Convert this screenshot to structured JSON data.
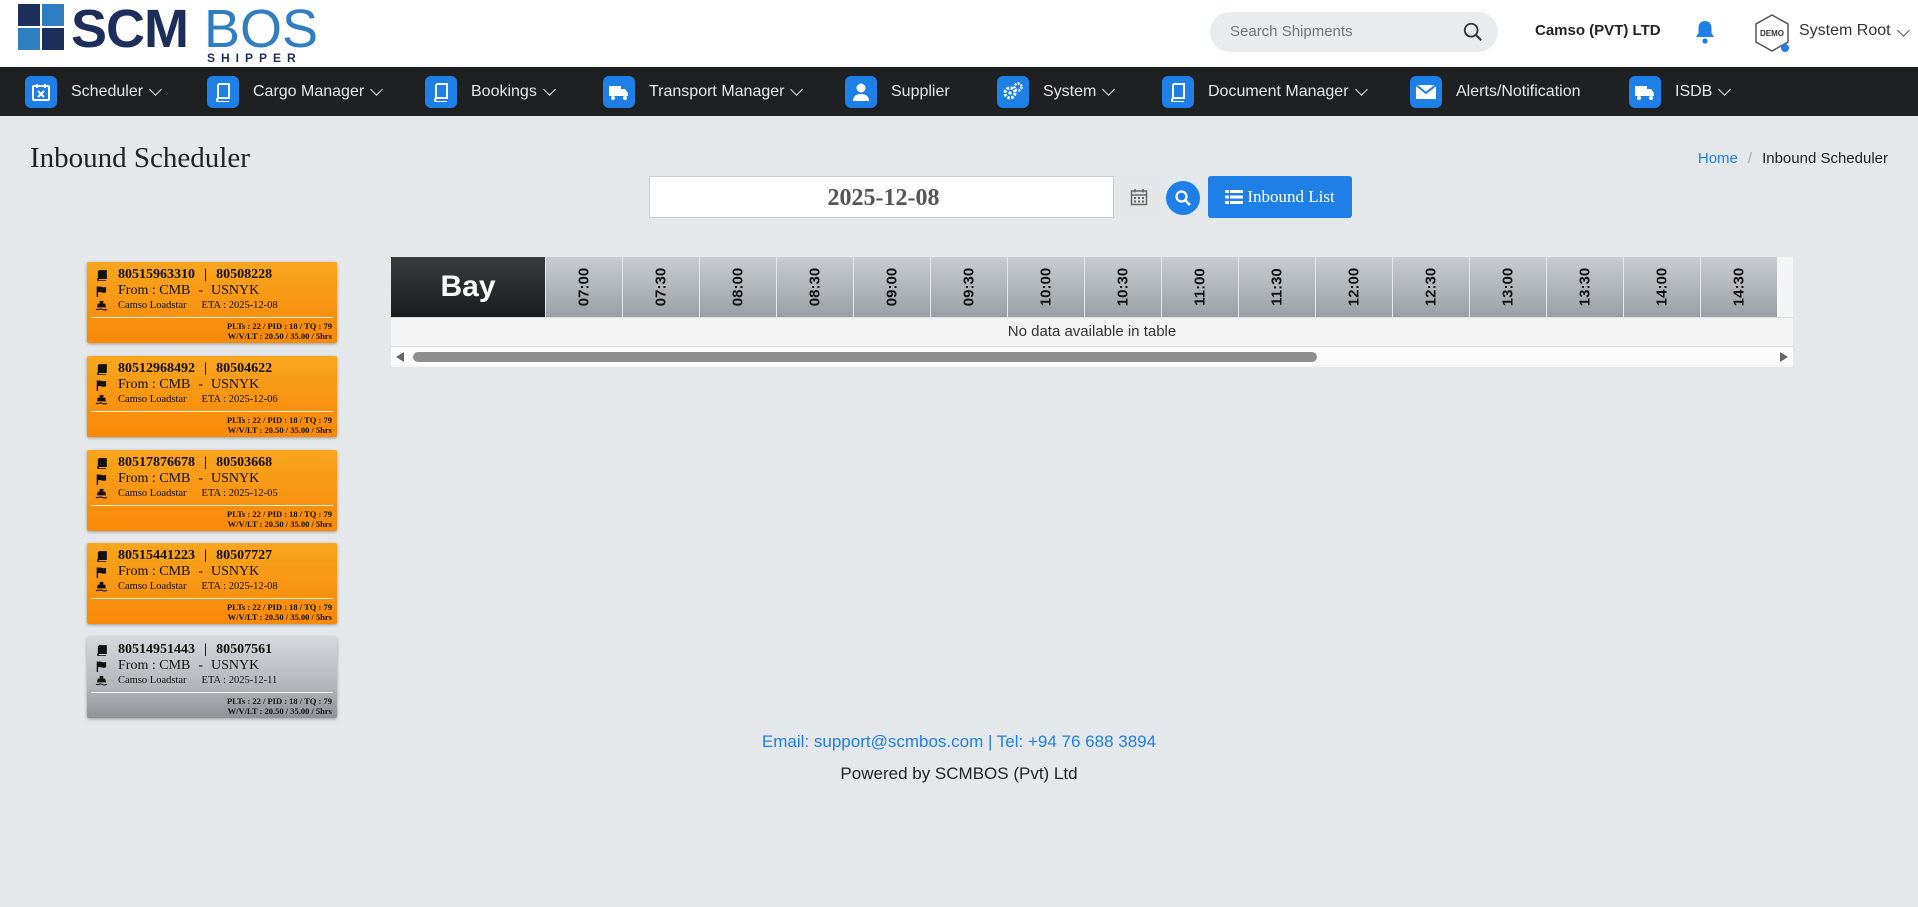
{
  "header": {
    "logo_main": "SCM",
    "logo_accent": "BOS",
    "logo_sub": "SHIPPER",
    "search_placeholder": "Search Shipments",
    "company": "Camso (PVT) LTD",
    "user_name": "System Root",
    "avatar_text": "DEMO"
  },
  "nav": [
    {
      "label": "Scheduler",
      "icon": "calendar-icon",
      "dropdown": true
    },
    {
      "label": "Cargo Manager",
      "icon": "book-icon",
      "dropdown": true
    },
    {
      "label": "Bookings",
      "icon": "book-icon",
      "dropdown": true
    },
    {
      "label": "Transport Manager",
      "icon": "truck-icon",
      "dropdown": true
    },
    {
      "label": "Supplier",
      "icon": "user-icon",
      "dropdown": false
    },
    {
      "label": "System",
      "icon": "gears-icon",
      "dropdown": true
    },
    {
      "label": "Document Manager",
      "icon": "book-icon",
      "dropdown": true
    },
    {
      "label": "Alerts/Notification",
      "icon": "envelope-icon",
      "dropdown": false
    },
    {
      "label": "ISDB",
      "icon": "truck-icon",
      "dropdown": true
    }
  ],
  "page": {
    "title": "Inbound Scheduler",
    "breadcrumb_home": "Home",
    "breadcrumb_current": "Inbound Scheduler",
    "date_value": "2025-12-08",
    "inbound_list_label": "Inbound List"
  },
  "cards": [
    {
      "ref1": "80515963310",
      "ref2": "80508228",
      "from": "From : CMB",
      "to": "USNYK",
      "vessel": "Camso Loadstar",
      "eta": "ETA : 2025-12-08",
      "stats1": "PLTs : 22 / PID : 18 / TQ : 79",
      "stats2": "W/V/LT : 20.50 / 35.00 / 5hrs",
      "status": "orange"
    },
    {
      "ref1": "80512968492",
      "ref2": "80504622",
      "from": "From : CMB",
      "to": "USNYK",
      "vessel": "Camso Loadstar",
      "eta": "ETA : 2025-12-06",
      "stats1": "PLTs : 22 / PID : 18 / TQ : 79",
      "stats2": "W/V/LT : 20.50 / 35.00 / 5hrs",
      "status": "orange"
    },
    {
      "ref1": "80517876678",
      "ref2": "80503668",
      "from": "From : CMB",
      "to": "USNYK",
      "vessel": "Camso Loadstar",
      "eta": "ETA : 2025-12-05",
      "stats1": "PLTs : 22 / PID : 18 / TQ : 79",
      "stats2": "W/V/LT : 20.50 / 35.00 / 5hrs",
      "status": "orange"
    },
    {
      "ref1": "80515441223",
      "ref2": "80507727",
      "from": "From : CMB",
      "to": "USNYK",
      "vessel": "Camso Loadstar",
      "eta": "ETA : 2025-12-08",
      "stats1": "PLTs : 22 / PID : 18 / TQ : 79",
      "stats2": "W/V/LT : 20.50 / 35.00 / 5hrs",
      "status": "orange"
    },
    {
      "ref1": "80514951443",
      "ref2": "80507561",
      "from": "From : CMB",
      "to": "USNYK",
      "vessel": "Camso Loadstar",
      "eta": "ETA : 2025-12-11",
      "stats1": "PLTs : 22 / PID : 18 / TQ : 79",
      "stats2": "W/V/LT : 20.50 / 35.00 / 5hrs",
      "status": "gray"
    }
  ],
  "schedule": {
    "bay_label": "Bay",
    "times": [
      "07:00",
      "07:30",
      "08:00",
      "08:30",
      "09:00",
      "09:30",
      "10:00",
      "10:30",
      "11:00",
      "11:30",
      "12:00",
      "12:30",
      "13:00",
      "13:30",
      "14:00",
      "14:30"
    ],
    "empty_message": "No data available in table"
  },
  "footer": {
    "contact": "Email: support@scmbos.com | Tel: +94 76 688 3894",
    "powered": "Powered by SCMBOS (Pvt) Ltd"
  },
  "colors": {
    "accent": "#1e7fe6",
    "nav_bg": "#1f2022",
    "card_orange": "#f7900f",
    "card_gray": "#b3b6ba"
  }
}
